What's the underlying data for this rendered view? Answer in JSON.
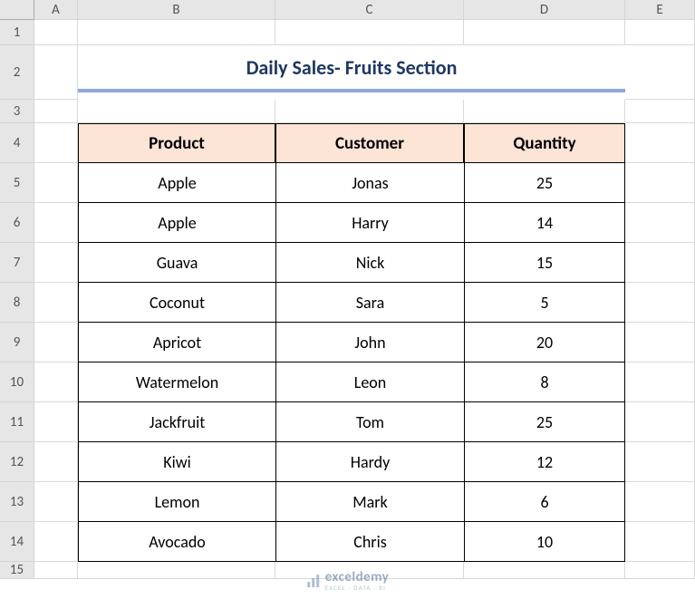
{
  "columns": [
    "A",
    "B",
    "C",
    "D",
    "E"
  ],
  "rows": [
    "1",
    "2",
    "3",
    "4",
    "5",
    "6",
    "7",
    "8",
    "9",
    "10",
    "11",
    "12",
    "13",
    "14",
    "15"
  ],
  "title": "Daily Sales- Fruits Section",
  "table": {
    "headers": [
      "Product",
      "Customer",
      "Quantity"
    ],
    "data": [
      {
        "product": "Apple",
        "customer": "Jonas",
        "quantity": "25"
      },
      {
        "product": "Apple",
        "customer": "Harry",
        "quantity": "14"
      },
      {
        "product": "Guava",
        "customer": "Nick",
        "quantity": "15"
      },
      {
        "product": "Coconut",
        "customer": "Sara",
        "quantity": "5"
      },
      {
        "product": "Apricot",
        "customer": "John",
        "quantity": "20"
      },
      {
        "product": "Watermelon",
        "customer": "Leon",
        "quantity": "8"
      },
      {
        "product": "Jackfruit",
        "customer": "Tom",
        "quantity": "25"
      },
      {
        "product": "Kiwi",
        "customer": "Hardy",
        "quantity": "12"
      },
      {
        "product": "Lemon",
        "customer": "Mark",
        "quantity": "6"
      },
      {
        "product": "Avocado",
        "customer": "Chris",
        "quantity": "10"
      }
    ]
  },
  "watermark": {
    "brand": "exceldemy",
    "tagline": "EXCEL · DATA · BI"
  }
}
